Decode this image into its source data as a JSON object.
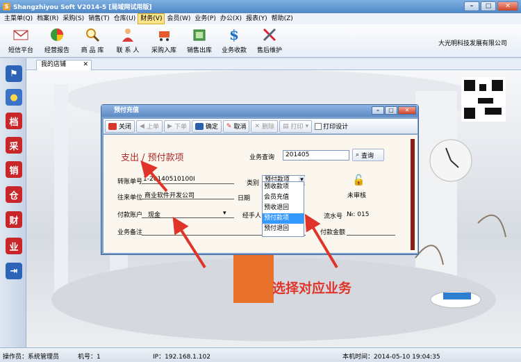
{
  "app": {
    "title": "Shangzhiyou Soft V2014-5 [局域网试用版]",
    "company": "大光明科技发展有限公司"
  },
  "menu": [
    "主菜单(Q)",
    "档案(R)",
    "采购(S)",
    "销售(T)",
    "仓库(U)",
    "财务(V)",
    "会员(W)",
    "业务(P)",
    "办公(X)",
    "报表(Y)",
    "帮助(Z)"
  ],
  "toolbar": [
    {
      "label": "短信平台",
      "icon": "envelope-icon"
    },
    {
      "label": "经营报告",
      "icon": "pie-chart-icon"
    },
    {
      "label": "商 品 库",
      "icon": "magnifier-icon"
    },
    {
      "label": "联 系 人",
      "icon": "person-icon"
    },
    {
      "label": "采购入库",
      "icon": "cart-icon"
    },
    {
      "label": "销售出库",
      "icon": "money-icon"
    },
    {
      "label": "业务收款",
      "icon": "dollar-icon"
    },
    {
      "label": "售后维护",
      "icon": "tools-icon"
    }
  ],
  "sidebar": [
    "flag-icon",
    "bulb-icon",
    "档",
    "采",
    "销",
    "仓",
    "财",
    "业",
    "exit-icon"
  ],
  "tab": {
    "label": "我的店铺",
    "close": "✕"
  },
  "dialog": {
    "title": "预付充值",
    "buttons": {
      "close": "关闭",
      "prev": "上单",
      "next": "下单",
      "confirm": "确定",
      "cancel": "取消",
      "delete": "删除",
      "print": "打印",
      "print_design": "打印设计"
    },
    "heading": "支出 / 预付款项",
    "search_label": "业务查询",
    "search_value": "201405",
    "search_button": "查询",
    "fields": {
      "doc_no_label": "转账单号",
      "doc_no": "1-20140510100I",
      "unit_label": "往来单位",
      "unit": "商业软件开发公司",
      "account_label": "付款账户",
      "account": "现金",
      "remark_label": "业务备注",
      "category_label": "类别",
      "category": "预付款项",
      "date_label": "日期",
      "handler_label": "经手人",
      "status": "未审核",
      "serial_label": "流水号",
      "serial": "№: 015",
      "amount_label": "付款金额"
    },
    "dropdown": [
      "预收款项",
      "会员充值",
      "预收退回",
      "预付款项",
      "预付退回"
    ],
    "dropdown_selected": 3
  },
  "annotation": "选择对应业务",
  "status": {
    "operator": "操作员：系统管理员",
    "machine": "机号：1",
    "ip": "IP：192.168.1.102",
    "time": "本机时间：2014-05-10 19:04:35"
  }
}
